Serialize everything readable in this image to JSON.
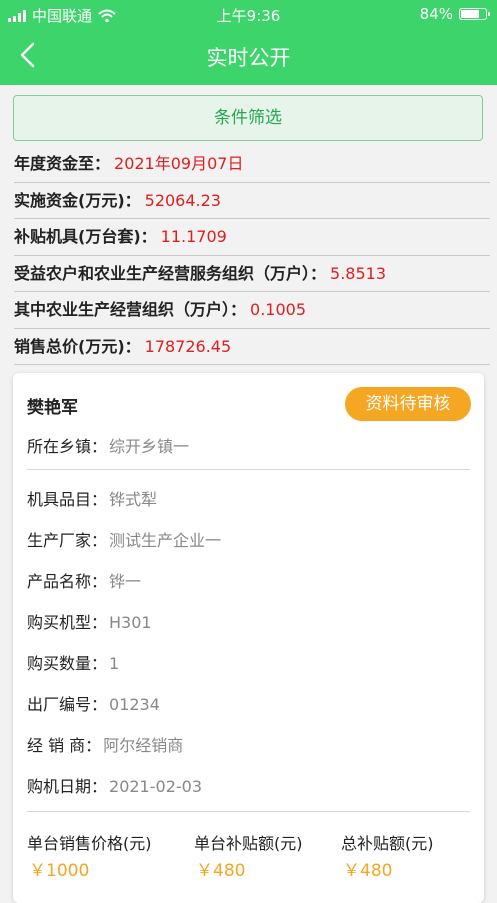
{
  "status_bar": {
    "carrier": "中国联通",
    "time": "上午9:36",
    "battery": "84%",
    "battery_level": 0.84
  },
  "nav": {
    "title": "实时公开"
  },
  "filter_button": "条件筛选",
  "summary": [
    {
      "label": "年度资金至：",
      "value": "2021年09月07日"
    },
    {
      "label": "实施资金(万元)：",
      "value": "52064.23"
    },
    {
      "label": "补贴机具(万台套)：",
      "value": "11.1709"
    },
    {
      "label": "受益农户和农业生产经营服务组织（万户）：",
      "value": "5.8513"
    },
    {
      "label": "其中农业生产经营组织（万户）：",
      "value": "0.1005"
    },
    {
      "label": "销售总价(万元)：",
      "value": "178726.45"
    }
  ],
  "record": {
    "name": "樊艳军",
    "status": "资料待审核",
    "town": {
      "label": "所在乡镇：",
      "value": "综开乡镇一"
    },
    "fields": [
      {
        "label": "机具品目：",
        "value": "铧式犁"
      },
      {
        "label": "生产厂家：",
        "value": "测试生产企业一"
      },
      {
        "label": "产品名称：",
        "value": "铧一"
      },
      {
        "label": "购买机型：",
        "value": "H301"
      },
      {
        "label": "购买数量：",
        "value": "1"
      },
      {
        "label": "出厂编号：",
        "value": "01234"
      },
      {
        "label": "经 销 商：",
        "value": "阿尔经销商"
      },
      {
        "label": "购机日期：",
        "value": "2021-02-03"
      }
    ],
    "totals": [
      {
        "label": "单台销售价格(元)",
        "value": "￥1000"
      },
      {
        "label": "单台补贴额(元)",
        "value": "￥480"
      },
      {
        "label": "总补贴额(元)",
        "value": "￥480"
      }
    ]
  },
  "colors": {
    "header": "#3dd46c",
    "accent_red": "#e01e1e",
    "badge_orange": "#f5a623"
  }
}
